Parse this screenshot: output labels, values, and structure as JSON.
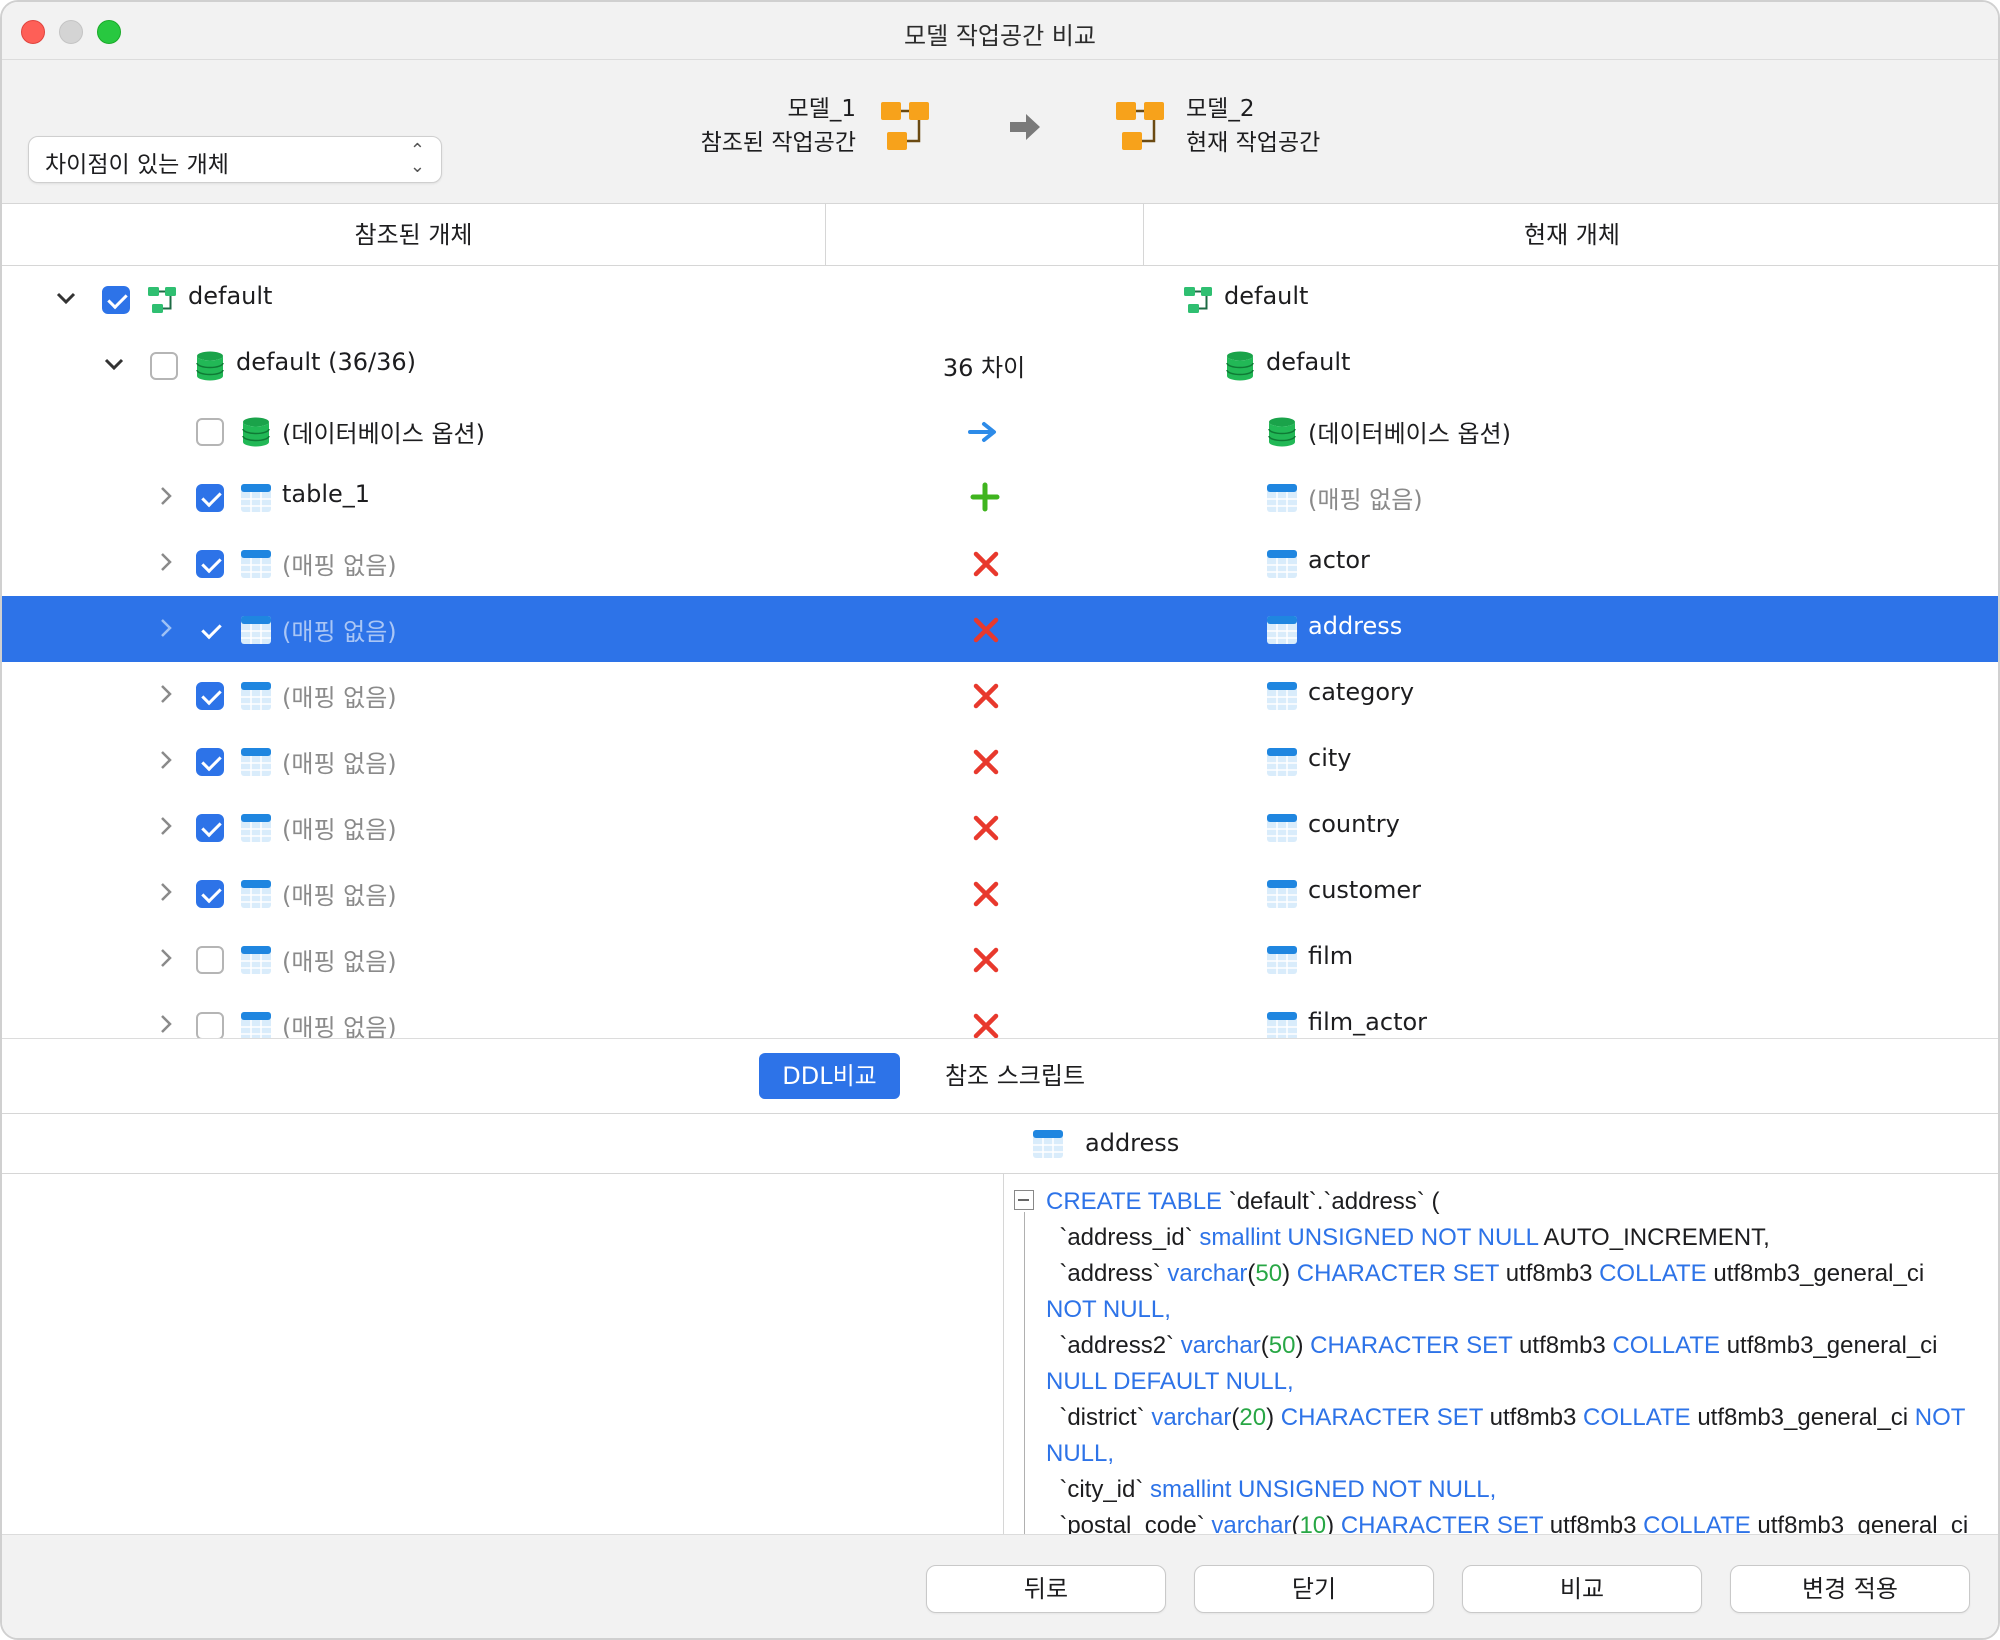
{
  "window": {
    "title": "모델 작업공간 비교"
  },
  "header": {
    "filter": {
      "value": "차이점이 있는 개체"
    },
    "source": {
      "name": "모델_1",
      "desc": "참조된 작업공간"
    },
    "target": {
      "name": "모델_2",
      "desc": "현재 작업공간"
    }
  },
  "columns": {
    "left": "참조된 개체",
    "middle": "",
    "right": "현재 개체"
  },
  "tree": {
    "rows": [
      {
        "left": "default",
        "status": "",
        "right": "default",
        "left_muted": false,
        "right_muted": false,
        "checked": true,
        "level": 0,
        "icon": "schema-icon"
      },
      {
        "left": "default (36/36)",
        "status": "36 차이",
        "right": "default",
        "left_muted": false,
        "right_muted": false,
        "checked": false,
        "level": 1,
        "icon": "database-icon"
      },
      {
        "left": "(데이터베이스 옵션)",
        "status": "arrow",
        "right": "(데이터베이스 옵션)",
        "left_muted": false,
        "right_muted": false,
        "checked": false,
        "level": 2,
        "icon": "database-icon"
      },
      {
        "left": "table_1",
        "status": "plus",
        "right": "(매핑 없음)",
        "left_muted": false,
        "right_muted": true,
        "checked": true,
        "level": 2,
        "icon": "table-icon"
      },
      {
        "left": "(매핑 없음)",
        "status": "cross",
        "right": "actor",
        "left_muted": true,
        "right_muted": false,
        "checked": true,
        "level": 2,
        "icon": "table-icon"
      },
      {
        "left": "(매핑 없음)",
        "status": "cross",
        "right": "address",
        "left_muted": true,
        "right_muted": false,
        "checked": true,
        "level": 2,
        "icon": "table-icon",
        "selected": true
      },
      {
        "left": "(매핑 없음)",
        "status": "cross",
        "right": "category",
        "left_muted": true,
        "right_muted": false,
        "checked": true,
        "level": 2,
        "icon": "table-icon"
      },
      {
        "left": "(매핑 없음)",
        "status": "cross",
        "right": "city",
        "left_muted": true,
        "right_muted": false,
        "checked": true,
        "level": 2,
        "icon": "table-icon"
      },
      {
        "left": "(매핑 없음)",
        "status": "cross",
        "right": "country",
        "left_muted": true,
        "right_muted": false,
        "checked": true,
        "level": 2,
        "icon": "table-icon"
      },
      {
        "left": "(매핑 없음)",
        "status": "cross",
        "right": "customer",
        "left_muted": true,
        "right_muted": false,
        "checked": true,
        "level": 2,
        "icon": "table-icon"
      },
      {
        "left": "(매핑 없음)",
        "status": "cross",
        "right": "film",
        "left_muted": true,
        "right_muted": false,
        "checked": false,
        "level": 2,
        "icon": "table-icon"
      },
      {
        "left": "(매핑 없음)",
        "status": "cross",
        "right": "film_actor",
        "left_muted": true,
        "right_muted": false,
        "checked": false,
        "level": 2,
        "icon": "table-icon"
      }
    ]
  },
  "tabs": {
    "ddl": "DDL비교",
    "script": "참조 스크립트"
  },
  "ddl": {
    "object": "address",
    "lines": [
      [
        {
          "t": "CREATE TABLE ",
          "c": "kw"
        },
        {
          "t": "`default`.`address` (",
          "c": ""
        }
      ],
      [
        {
          "t": "  `address_id` ",
          "c": ""
        },
        {
          "t": "smallint UNSIGNED NOT NULL ",
          "c": "kw"
        },
        {
          "t": "AUTO_INCREMENT,",
          "c": ""
        }
      ],
      [
        {
          "t": "  `address` ",
          "c": ""
        },
        {
          "t": "varchar",
          "c": "kw"
        },
        {
          "t": "(",
          "c": ""
        },
        {
          "t": "50",
          "c": "num"
        },
        {
          "t": ") ",
          "c": ""
        },
        {
          "t": "CHARACTER SET ",
          "c": "kw"
        },
        {
          "t": "utf8mb3 ",
          "c": ""
        },
        {
          "t": "COLLATE ",
          "c": "kw"
        },
        {
          "t": "utf8mb3_general_ci",
          "c": ""
        }
      ],
      [
        {
          "t": "NOT NULL,",
          "c": "kw"
        }
      ],
      [
        {
          "t": "  `address2` ",
          "c": ""
        },
        {
          "t": "varchar",
          "c": "kw"
        },
        {
          "t": "(",
          "c": ""
        },
        {
          "t": "50",
          "c": "num"
        },
        {
          "t": ") ",
          "c": ""
        },
        {
          "t": "CHARACTER SET ",
          "c": "kw"
        },
        {
          "t": "utf8mb3 ",
          "c": ""
        },
        {
          "t": "COLLATE ",
          "c": "kw"
        },
        {
          "t": "utf8mb3_general_ci",
          "c": ""
        }
      ],
      [
        {
          "t": "NULL DEFAULT NULL,",
          "c": "kw"
        }
      ],
      [
        {
          "t": "  `district` ",
          "c": ""
        },
        {
          "t": "varchar",
          "c": "kw"
        },
        {
          "t": "(",
          "c": ""
        },
        {
          "t": "20",
          "c": "num"
        },
        {
          "t": ") ",
          "c": ""
        },
        {
          "t": "CHARACTER SET ",
          "c": "kw"
        },
        {
          "t": "utf8mb3 ",
          "c": ""
        },
        {
          "t": "COLLATE ",
          "c": "kw"
        },
        {
          "t": "utf8mb3_general_ci ",
          "c": ""
        },
        {
          "t": "NOT",
          "c": "kw"
        }
      ],
      [
        {
          "t": "NULL,",
          "c": "kw"
        }
      ],
      [
        {
          "t": "  `city_id` ",
          "c": ""
        },
        {
          "t": "smallint UNSIGNED NOT NULL,",
          "c": "kw"
        }
      ],
      [
        {
          "t": "  `postal_code` ",
          "c": ""
        },
        {
          "t": "varchar",
          "c": "kw"
        },
        {
          "t": "(",
          "c": ""
        },
        {
          "t": "10",
          "c": "num"
        },
        {
          "t": ") ",
          "c": ""
        },
        {
          "t": "CHARACTER SET ",
          "c": "kw"
        },
        {
          "t": "utf8mb3 ",
          "c": ""
        },
        {
          "t": "COLLATE ",
          "c": "kw"
        },
        {
          "t": "utf8mb3_general_ci",
          "c": ""
        }
      ]
    ]
  },
  "footer": {
    "back": "뒤로",
    "close": "닫기",
    "compare": "비교",
    "apply": "변경 적용"
  },
  "colors": {
    "accent": "#2d73e8",
    "add": "#3fb41e",
    "remove": "#e8392d",
    "arrow": "#2d8be8"
  }
}
